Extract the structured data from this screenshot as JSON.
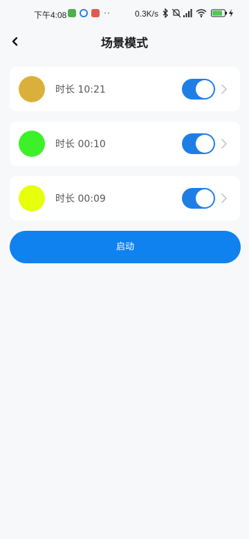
{
  "status_bar": {
    "time": "下午4:08",
    "dots": "··",
    "net_speed": "0.3K/s",
    "battery_level": "80"
  },
  "header": {
    "title": "场景模式",
    "back_icon": "chevron-left-icon"
  },
  "scenes": [
    {
      "color": "#dbb03a",
      "duration_label": "时长 10:21",
      "enabled": true
    },
    {
      "color": "#3cf02a",
      "duration_label": "时长 00:10",
      "enabled": true
    },
    {
      "color": "#e6ff0a",
      "duration_label": "时长 00:09",
      "enabled": true
    }
  ],
  "start_button": {
    "label": "启动"
  },
  "colors": {
    "accent": "#1e7ee6",
    "start_button": "#0f82ef",
    "background": "#f7f8fa"
  }
}
